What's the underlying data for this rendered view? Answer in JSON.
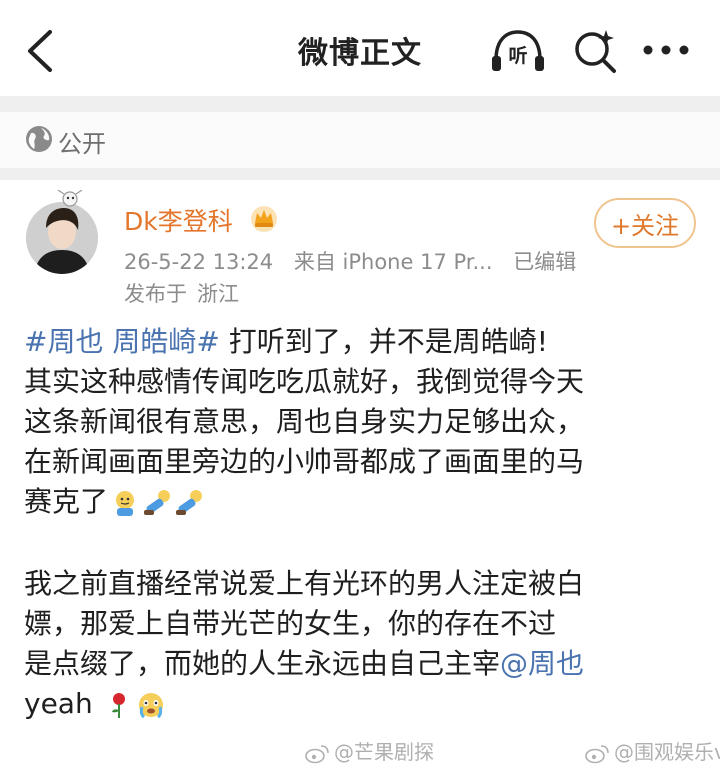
{
  "header": {
    "title": "微博正文",
    "listen_label": "听",
    "back_icon": "back-arrow-icon",
    "search_icon": "search-sparkle-icon",
    "more_icon": "more-dots-icon"
  },
  "visibility": {
    "icon": "globe-icon",
    "label": "公开"
  },
  "post": {
    "author": "Dk李登科",
    "follow_label": "+关注",
    "time": "26-5-22 13:24",
    "source": "来自 iPhone 17 Pr...",
    "edited": "已编辑",
    "location_prefix": "发布于",
    "location": "浙江",
    "tag": "#周也 周皓崎#",
    "line1_rest": " 打听到了，并不是周皓崎!",
    "line2": "其实这种感情传闻吃吃瓜就好，我倒觉得今天",
    "line3": "这条新闻很有意思，周也自身实力足够出众，",
    "line4": "在新闻画面里旁边的小帅哥都成了画面里的马",
    "line5": "赛克了",
    "line6": "我之前直播经常说爱上有光环的男人注定被白",
    "line7": "嫖，那爱上自带光芒的女生，你的存在不过",
    "line8_text": "是点缀了，而她的人生永远由自己主宰",
    "mention": "@周也",
    "line9_text": "yeah",
    "emojis_line5": [
      "doge-icon",
      "lying-flat-icon",
      "lying-flat-icon"
    ],
    "emojis_line9": [
      "rose-icon",
      "crying-face-icon"
    ]
  },
  "watermarks": [
    "@芒果剧探",
    "@围观娱乐v"
  ],
  "colors": {
    "accent": "#e4762c",
    "link": "#4a73b0",
    "meta": "#8c8c8c"
  }
}
